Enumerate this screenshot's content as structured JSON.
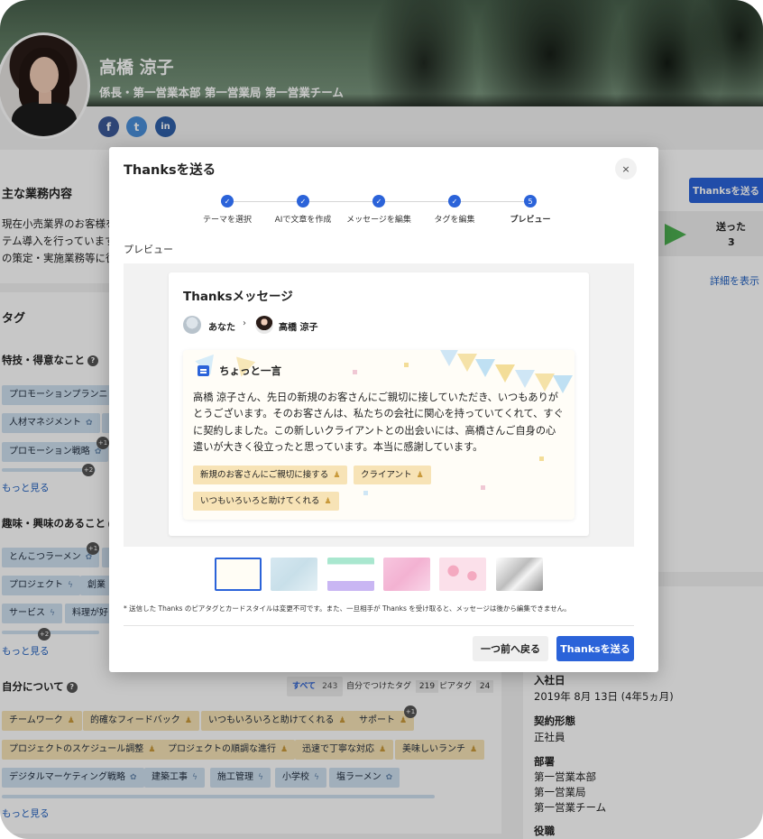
{
  "profile": {
    "name": "高橋 涼子",
    "title": "係長・第一営業本部 第一営業局 第一営業チーム",
    "social": [
      "f",
      "t",
      "in"
    ]
  },
  "background": {
    "duties_heading": "主な業務内容",
    "duties_lines": [
      "現在小売業界のお客様を",
      "テム導入を行っています",
      "の策定・実施業務等に従"
    ],
    "tags_heading": "タグ",
    "special_heading": "特技・得意なこと",
    "special_chips": [
      "プロモーションプランニン",
      "人材マネジメント",
      "プロモーション戦略"
    ],
    "hobby_heading": "趣味・興味のあること",
    "hobby_chips": [
      "とんこつラーメン",
      "プロジェクト",
      "創業",
      "サービス",
      "料理が好き"
    ],
    "more": "もっと見る",
    "about_heading": "自分について",
    "filters": [
      {
        "label": "すべて",
        "count": "243"
      },
      {
        "label": "自分でつけたタグ",
        "count": "219"
      },
      {
        "label": "ピアタグ",
        "count": "24"
      }
    ],
    "about_chips": [
      "チームワーク",
      "的確なフィードバック",
      "いつもいろいろと助けてくれる",
      "サポート",
      "プロジェクトのスケジュール調整",
      "プロジェクトの順調な進行",
      "迅速で丁寧な対応",
      "美味しいランチ",
      "デジタルマーケティング戦略",
      "建築工事",
      "施工管理",
      "小学校",
      "塩ラーメン"
    ],
    "badges": [
      "+1",
      "+2",
      "+1",
      "+2",
      "+1"
    ],
    "right": {
      "thanks_button": "Thanksを送る",
      "sent_label": "送った",
      "sent_count": "3",
      "detail_link": "詳細を表示",
      "joined_label": "入社日",
      "joined_value": "2019年 8月 13日 (4年5ヵ月)",
      "contract_label": "契約形態",
      "contract_value": "正社員",
      "dept_label": "部署",
      "dept_values": [
        "第一営業本部",
        "第一営業局",
        "第一営業チーム"
      ],
      "role_label": "役職"
    }
  },
  "modal": {
    "title": "Thanksを送る",
    "close": "×",
    "steps": [
      {
        "label": "テーマを選択",
        "mark": "✓"
      },
      {
        "label": "AIで文章を作成",
        "mark": "✓"
      },
      {
        "label": "メッセージを編集",
        "mark": "✓"
      },
      {
        "label": "タグを編集",
        "mark": "✓"
      },
      {
        "label": "プレビュー",
        "mark": "5"
      }
    ],
    "preview_label": "プレビュー",
    "card_title": "Thanksメッセージ",
    "from": "あなた",
    "arrow": "›",
    "to": "高橋 涼子",
    "message_heading": "ちょっと一言",
    "message": "高橋 涼子さん、先日の新規のお客さんにご親切に接していただき、いつもありがとうございます。そのお客さんは、私たちの会社に関心を持っていてくれて、すぐに契約しました。この新しいクライアントとの出会いには、高橋さんご自身の心遣いが大きく役立ったと思っています。本当に感謝しています。",
    "tags": [
      "新規のお客さんにご親切に接する",
      "クライアント",
      "いつもいろいろと助けてくれる"
    ],
    "notice": "* 送信した Thanks のピアタグとカードスタイルは変更不可です。また、一旦相手が Thanks を受け取ると、メッセージは後から編集できません。",
    "back_button": "一つ前へ戻る",
    "send_button": "Thanksを送る"
  },
  "colors": {
    "primary": "#2b63d9",
    "chip_blue": "#cfe0f0",
    "chip_yellow": "#f7e3b6",
    "sent_arrow": "#4caf50"
  },
  "icons": {
    "person": "person-icon",
    "gear": "gear-icon",
    "bolt": "bolt-icon"
  }
}
